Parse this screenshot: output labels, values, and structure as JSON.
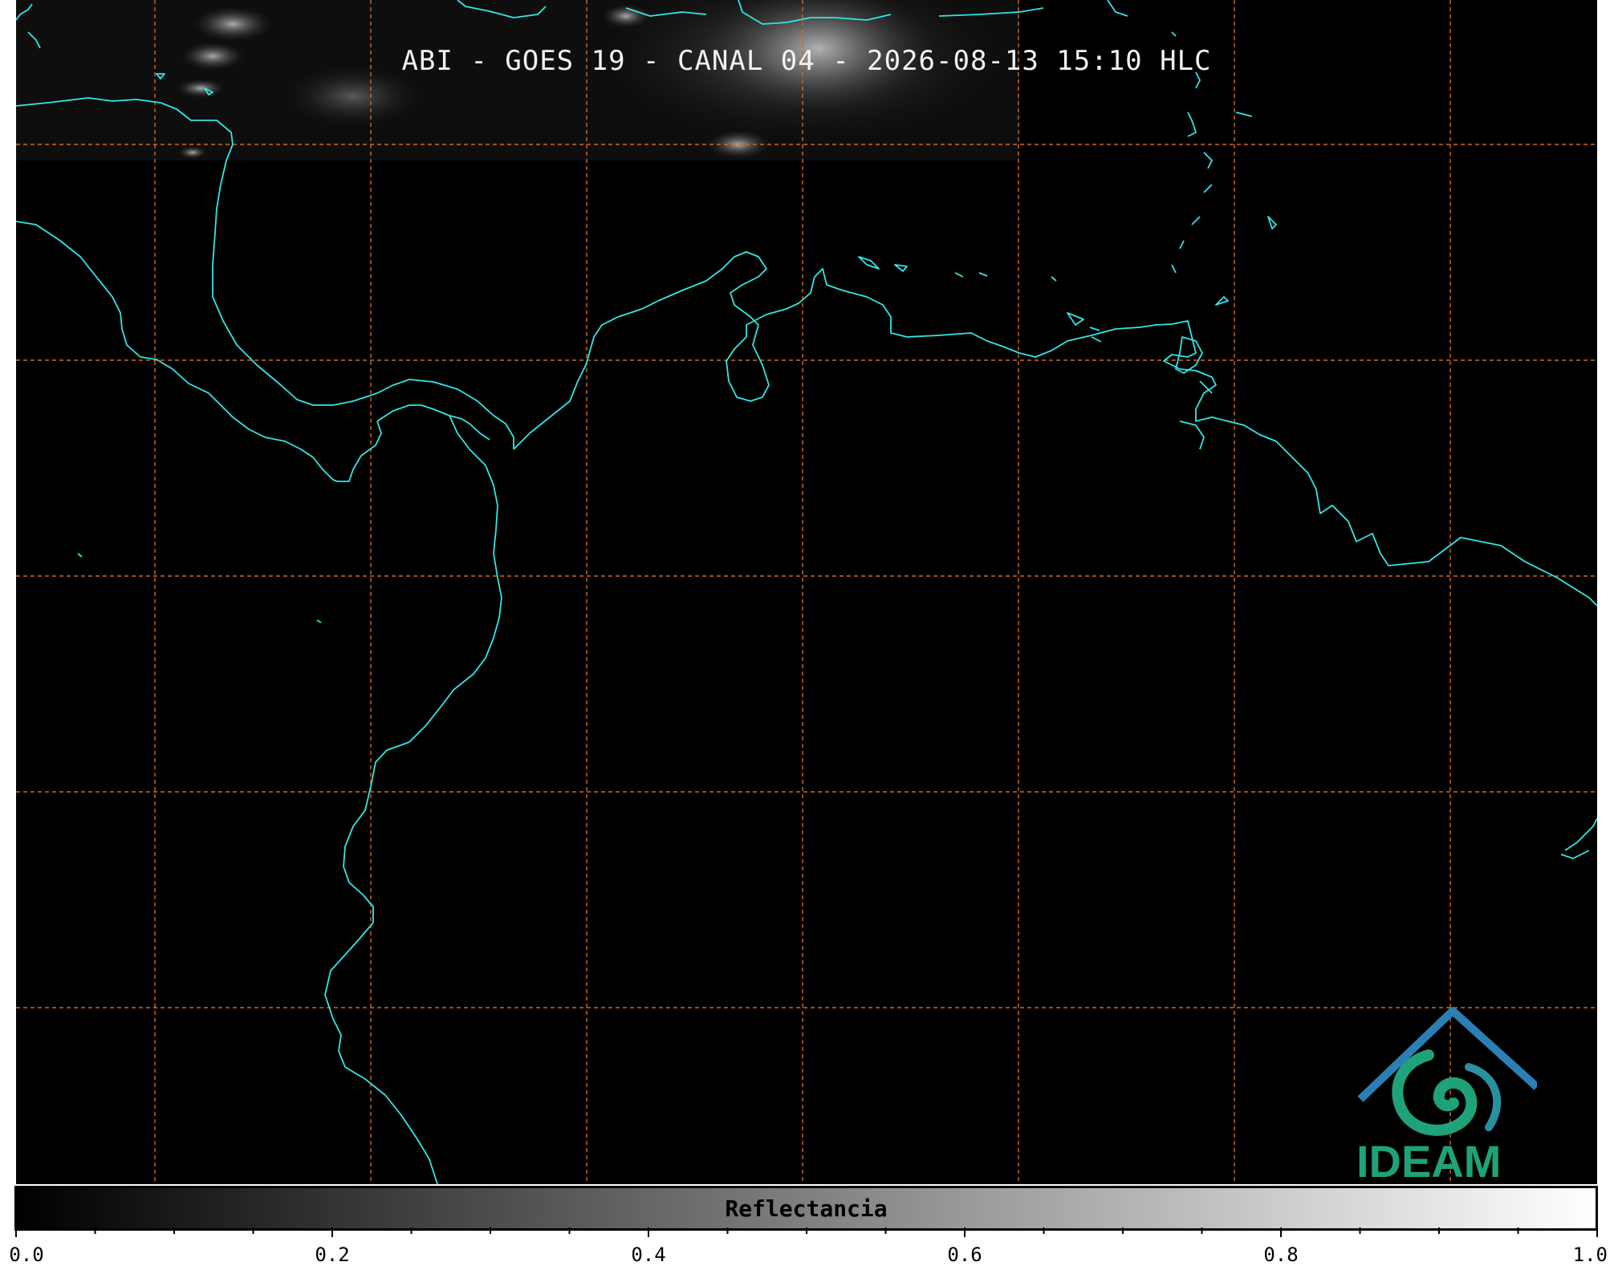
{
  "title": "ABI - GOES 19 - CANAL 04 - 2026-08-13 15:10 HLC",
  "colorbar": {
    "label": "Reflectancia",
    "ticks": [
      "0.0",
      "0.2",
      "0.4",
      "0.6",
      "0.8",
      "1.0"
    ],
    "range": [
      0.0,
      1.0
    ]
  },
  "logo": {
    "text": "IDEAM"
  },
  "colors": {
    "background": "#000000",
    "coastline": "#33e6e6",
    "graticule": "#d2691e",
    "logo_primary": "#1fa27a",
    "logo_secondary": "#2a7fb5"
  }
}
